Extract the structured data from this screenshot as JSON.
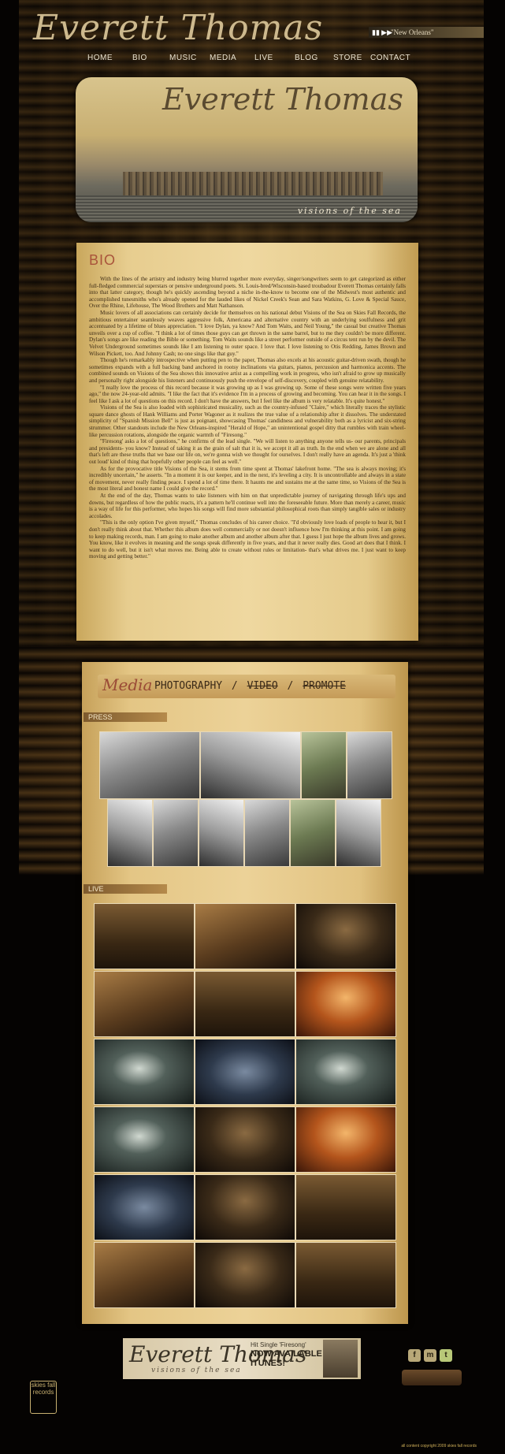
{
  "header": {
    "logo_text": "Everett Thomas",
    "player": {
      "controls": "▮▮ ▶▶",
      "now_playing": "\"New Orleans\""
    },
    "nav": [
      "HOME",
      "BIO",
      "MUSIC",
      "MEDIA",
      "LIVE",
      "BLOG",
      "STORE",
      "CONTACT"
    ]
  },
  "banner": {
    "title": "Everett Thomas",
    "subtitle": "visions of the sea"
  },
  "bio": {
    "heading": "BIO",
    "paragraphs": [
      "With the lines of the artistry and industry being blurred together more everyday, singer/songwriters seem to get categorized as either full-fledged commercial superstars or pensive underground poets. St. Louis-bred/Wisconsin-based troubadour Everett Thomas certainly falls into that latter category, though he's quickly ascending beyond a niche in-the-know to become one of the Midwest's most authentic and accomplished tunesmiths who's already opened for the lauded likes of Nickel Creek's Sean and Sara Watkins, G. Love & Special Sauce, Over the Rhine, Lifehouse, The Wood Brothers and Matt Nathanson.",
      "Music lovers of all associations can certainly decide for themselves on his national debut Visions of the Sea on Skies Fall Records, the ambitious entertainer seamlessly weaves aggressive folk, Americana and alternative country with an underlying soulfulness and grit accentuated by a lifetime of blues appreciation. \"I love Dylan, ya know? And Tom Waits, and Neil Young,\" the casual but creative Thomas unveils over a cup of coffee. \"I think a lot of times those guys can get thrown in the same barrel, but to me they couldn't be more different. Dylan's songs are like reading the Bible or something. Tom Waits sounds like a street performer outside of a circus tent run by the devil. The Velvet Underground sometimes sounds like I am listening to outer space. I love that. I love listening to Otis Redding, James Brown and Wilson Pickett, too. And Johnny Cash; no one sings like that guy.\"",
      "Though he's remarkably introspective when putting pen to the paper, Thomas also excels at his acoustic guitar-driven swath, though he sometimes expands with a full backing band anchored in rootsy inclinations via guitars, pianos, percussion and harmonica accents. The combined sounds on Visions of the Sea shows this innovative artist as a compelling work in progress, who isn't afraid to grow up musically and personally right alongside his listeners and continuously push the envelope of self-discovery, coupled with genuine relatability.",
      "\"I really love the process of this record because it was growing up as I was growing up. Some of these songs were written five years ago,\" the now 24-year-old admits. \"I like the fact that it's evidence I'm in a process of growing and becoming. You can hear it in the songs. I feel like I ask a lot of questions on this record. I don't have the answers, but I feel like the album is very relatable. It's quite honest.\"",
      "Visions of the Sea is also loaded with sophisticated musicality, such as the country-infused \"Claire,\" which literally traces the stylistic square dance ghosts of Hank Williams and Porter Wagoner as it realizes the true value of a relationship after it dissolves. The understated simplicity of \"Spanish Mission Bell\" is just as poignant, showcasing Thomas' candidness and vulnerability both as a lyricist and six-string strummer. Other standouts include the New Orleans-inspired \"Herald of Hope,\" an unintentional gospel ditty that rumbles with train wheel-like percussion rotations, alongside the organic warmth of \"Firesong.\"",
      "\"Firesong' asks a lot of questions,\" he confirms of the lead single. \"We will listen to anything anyone tells us- our parents, principals and presidents- you know? Instead of taking it as the grain of salt that it is, we accept it all as truth. In the end when we are alone and all that's left are these truths that we base our life on, we're gonna wish we thought for ourselves. I don't really have an agenda. It's just a 'think out loud' kind of thing that hopefully other people can feel as well.\"",
      "As for the provocative title Visions of the Sea, it stems from time spent at Thomas' lakefront home. \"The sea is always moving; it's incredibly uncertain,\" he asserts. \"In a moment it is our keeper, and in the next, it's leveling a city. It is uncontrollable and always in a state of movement, never really finding peace. I spend a lot of time there. It haunts me and sustains me at the same time, so Visions of the Sea is the most literal and honest name I could give the record.\"",
      "At the end of the day, Thomas wants to take listeners with him on that unpredictable journey of navigating through life's ups and downs, but regardless of how the public reacts, it's a pattern he'll continue well into the foreseeable future. More than merely a career, music is a way of life for this performer, who hopes his songs will find more substantial philosophical roots than simply tangible sales or industry accolades.",
      "\"This is the only option I've given myself,\" Thomas concludes of his career choice. \"I'd obviously love loads of people to hear it, but I don't really think about that. Whether this album does well commercially or not doesn't influence how I'm thinking at this point. I am going to keep making records, man. I am going to make another album and another album after that. I guess I just hope the album lives and grows. You know, like it evolves in meaning and the songs speak differently in five years, and that it never really dies. Good art does that I think. I want to do well, but it isn't what moves me. Being able to create without rules or limitation- that's what drives me. I just want to keep moving and getting better.\""
    ]
  },
  "media": {
    "title": "Media",
    "links": [
      "PHOTOGRAPHY",
      "/",
      "VIDEO",
      "/",
      "PROMOTE"
    ],
    "press_label": "PRESS",
    "live_label": "LIVE"
  },
  "footer": {
    "ad_name": "Everett Thomas",
    "ad_sub": "visions of the sea",
    "ad_hit": "Hit Single 'Firesong'",
    "ad_now": "NOW AVAILABLE ON ITUNES!",
    "social": [
      "f",
      "m",
      "t"
    ],
    "label": "skies fall records",
    "copyright": "all content copyright 2009 skies fall records"
  }
}
